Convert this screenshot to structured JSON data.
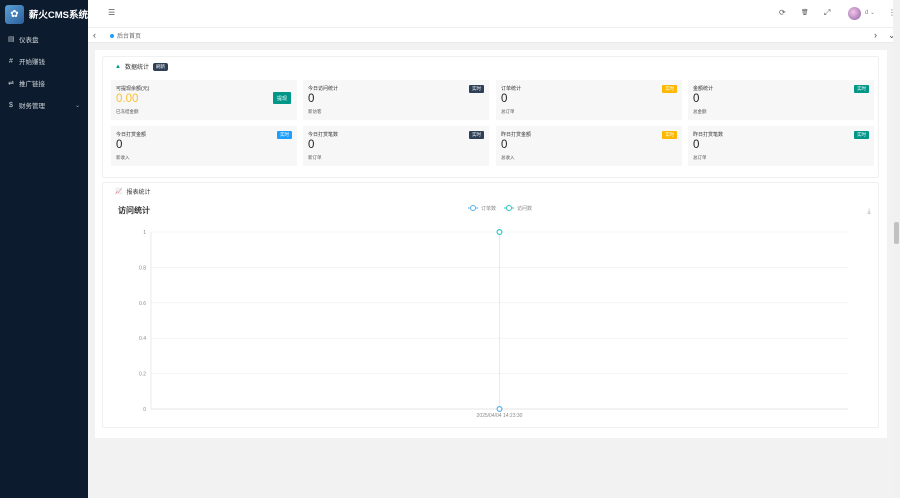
{
  "app": {
    "title": "薪火CMS系统",
    "logo_glyph": "✿"
  },
  "sidebar": {
    "items": [
      {
        "label": "仪表盘",
        "icon": "dashboard-icon",
        "glyph": "▤"
      },
      {
        "label": "开始赚钱",
        "icon": "hash-icon",
        "glyph": "#"
      },
      {
        "label": "推广链接",
        "icon": "usb-icon",
        "glyph": "⇌"
      },
      {
        "label": "财务管理",
        "icon": "dollar-icon",
        "glyph": "$",
        "chevron": "⌄"
      }
    ]
  },
  "topbar": {
    "menu_glyph": "☰",
    "refresh_glyph": "⟳",
    "clear_glyph": "🗑",
    "fullscreen_glyph": "⤢",
    "username": "d",
    "user_caret": "⌄",
    "more_glyph": "⋮"
  },
  "tabs": {
    "prev_glyph": "‹",
    "next_glyph": "›",
    "down_glyph": "⌄",
    "active": "后台首页"
  },
  "data_section": {
    "title": "数据统计",
    "badge": "刷新",
    "warn_glyph": "▲",
    "withdraw_button": "提现"
  },
  "stats": [
    {
      "label": "可提现余额(元)",
      "value": "0.00",
      "sub": "已冻结金额",
      "tag": "",
      "tag_color": ""
    },
    {
      "label": "今日访问统计",
      "value": "0",
      "sub": "新访客",
      "tag": "实时",
      "tag_color": "#2f4056"
    },
    {
      "label": "订单统计",
      "value": "0",
      "sub": "总订单",
      "tag": "实时",
      "tag_color": "#ffb800"
    },
    {
      "label": "金额统计",
      "value": "0",
      "sub": "总金额",
      "tag": "实时",
      "tag_color": "#009688"
    },
    {
      "label": "今日打赏金额",
      "value": "0",
      "sub": "新收入",
      "tag": "实时",
      "tag_color": "#1e9fff"
    },
    {
      "label": "今日打赏笔数",
      "value": "0",
      "sub": "新订单",
      "tag": "实时",
      "tag_color": "#2f4056"
    },
    {
      "label": "昨日打赏金额",
      "value": "0",
      "sub": "总收入",
      "tag": "实时",
      "tag_color": "#ffb800"
    },
    {
      "label": "昨日打赏笔数",
      "value": "0",
      "sub": "总订单",
      "tag": "实时",
      "tag_color": "#009688"
    }
  ],
  "report_section": {
    "title": "报表统计",
    "icon_glyph": "📈"
  },
  "chart": {
    "title": "访问统计",
    "download_glyph": "⤓",
    "legend": [
      {
        "label": "订单数",
        "color": "#5ab1ef"
      },
      {
        "label": "访问数",
        "color": "#2ec7c9"
      }
    ]
  },
  "chart_data": {
    "type": "line",
    "title": "访问统计",
    "x": [
      "2025/04/04 14:23:30"
    ],
    "series": [
      {
        "name": "订单数",
        "values": [
          0
        ],
        "color": "#5ab1ef"
      },
      {
        "name": "访问数",
        "values": [
          1
        ],
        "color": "#2ec7c9"
      }
    ],
    "y_ticks": [
      "0",
      "0.2",
      "0.4",
      "0.6",
      "0.8",
      "1"
    ],
    "ylim": [
      0,
      1
    ],
    "grid": true,
    "legend_position": "top-center"
  }
}
